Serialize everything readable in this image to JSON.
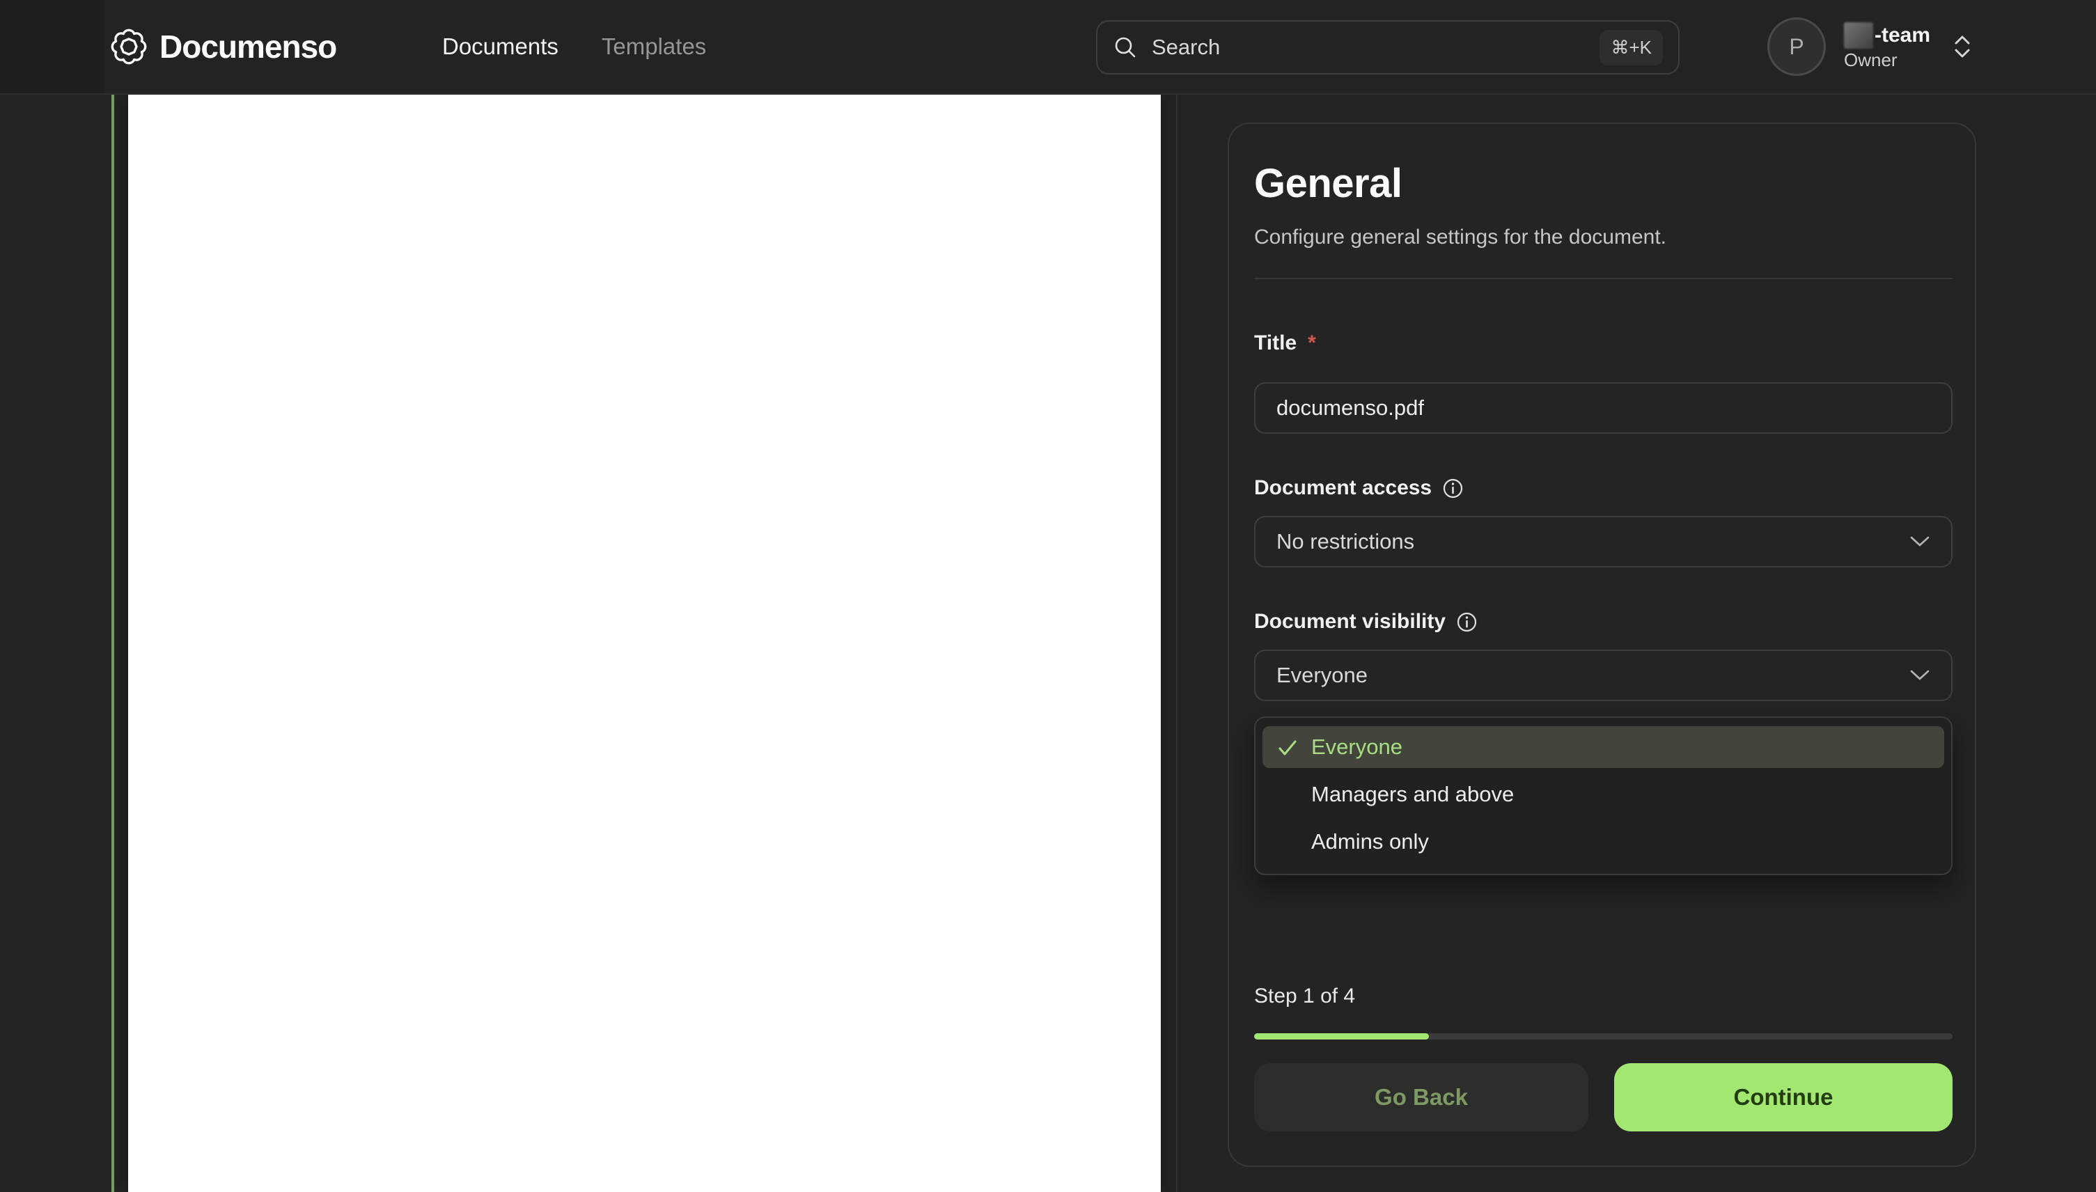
{
  "navbar": {
    "logo_text": "Documenso",
    "nav_items": [
      {
        "label": "Documents",
        "active": true
      },
      {
        "label": "Templates",
        "active": false
      }
    ],
    "search": {
      "placeholder": "Search",
      "shortcut": "⌘+K"
    },
    "account": {
      "avatar_initial": "P",
      "team_name_suffix": "-team",
      "role": "Owner"
    }
  },
  "panel": {
    "title": "General",
    "subtitle": "Configure general settings for the document.",
    "fields": {
      "title": {
        "label": "Title",
        "required_marker": "*",
        "value": "documenso.pdf"
      },
      "access": {
        "label": "Document access",
        "value": "No restrictions"
      },
      "visibility": {
        "label": "Document visibility",
        "value": "Everyone"
      }
    },
    "visibility_dropdown": {
      "options": [
        {
          "label": "Everyone",
          "selected": true
        },
        {
          "label": "Managers and above",
          "selected": false
        },
        {
          "label": "Admins only",
          "selected": false
        }
      ]
    },
    "stepper": {
      "label": "Step 1 of 4",
      "progress_percent": 25
    },
    "buttons": {
      "back": "Go Back",
      "continue": "Continue"
    }
  },
  "colors": {
    "accent_green": "#a2e771",
    "accent_green_muted": "#7f9e63",
    "selected_option_text": "#a8df82",
    "danger_red": "#d4584c",
    "page_background": "#242424",
    "navbar_background": "#232323",
    "card_border": "#383838",
    "document_page": "#ffffff"
  }
}
